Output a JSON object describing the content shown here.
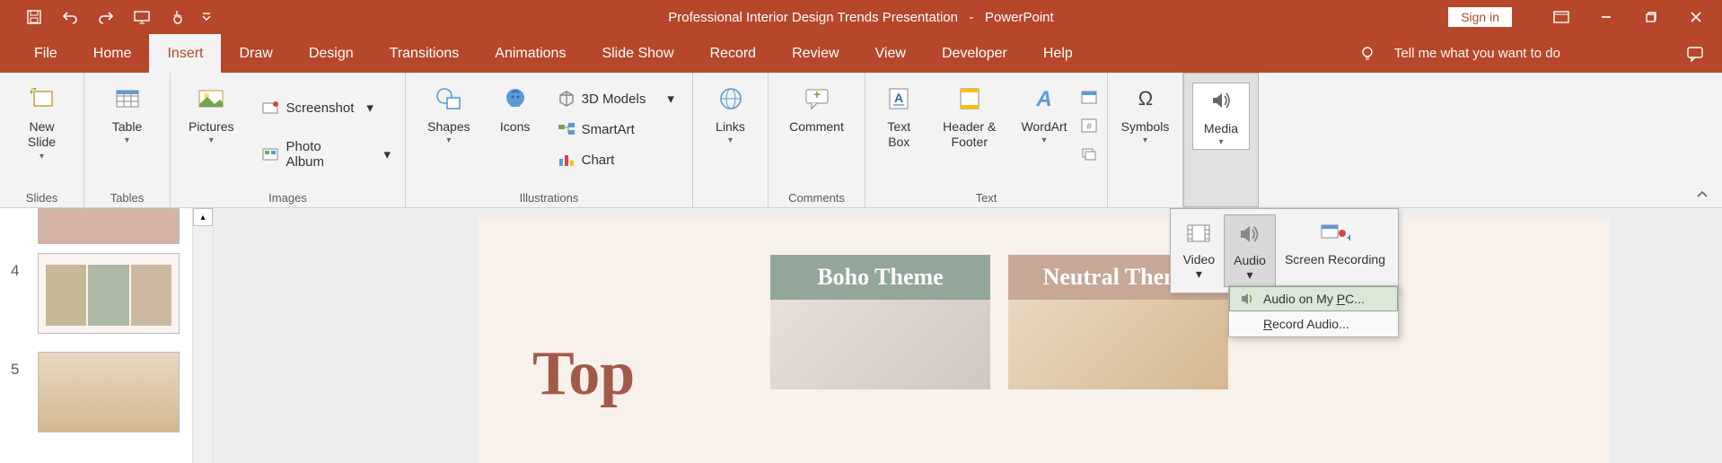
{
  "titlebar": {
    "document_title": "Professional Interior Design Trends Presentation",
    "app_name": "PowerPoint",
    "signin": "Sign in"
  },
  "tabs": [
    "File",
    "Home",
    "Insert",
    "Draw",
    "Design",
    "Transitions",
    "Animations",
    "Slide Show",
    "Record",
    "Review",
    "View",
    "Developer",
    "Help"
  ],
  "active_tab": "Insert",
  "tellme": "Tell me what you want to do",
  "ribbon": {
    "slides": {
      "new_slide": "New Slide",
      "label": "Slides"
    },
    "tables": {
      "table": "Table",
      "label": "Tables"
    },
    "images": {
      "pictures": "Pictures",
      "screenshot": "Screenshot",
      "photo_album": "Photo Album",
      "label": "Images"
    },
    "illustrations": {
      "shapes": "Shapes",
      "icons": "Icons",
      "models": "3D Models",
      "smartart": "SmartArt",
      "chart": "Chart",
      "label": "Illustrations"
    },
    "links": {
      "links": "Links"
    },
    "comments": {
      "comment": "Comment",
      "label": "Comments"
    },
    "text": {
      "textbox": "Text Box",
      "headerfooter": "Header & Footer",
      "wordart": "WordArt",
      "label": "Text"
    },
    "symbols": {
      "symbols": "Symbols"
    },
    "media": {
      "media": "Media"
    }
  },
  "media_dropdown": {
    "video": "Video",
    "audio": "Audio",
    "screen_recording": "Screen Recording"
  },
  "audio_menu": {
    "on_pc_prefix": "Audio on My ",
    "on_pc_u": "P",
    "on_pc_suffix": "C...",
    "record_u": "R",
    "record_suffix": "ecord Audio..."
  },
  "slide": {
    "title": "Top",
    "boho": "Boho Theme",
    "neutral": "Neutral Theme"
  },
  "slide_numbers": {
    "n4": "4",
    "n5": "5"
  }
}
